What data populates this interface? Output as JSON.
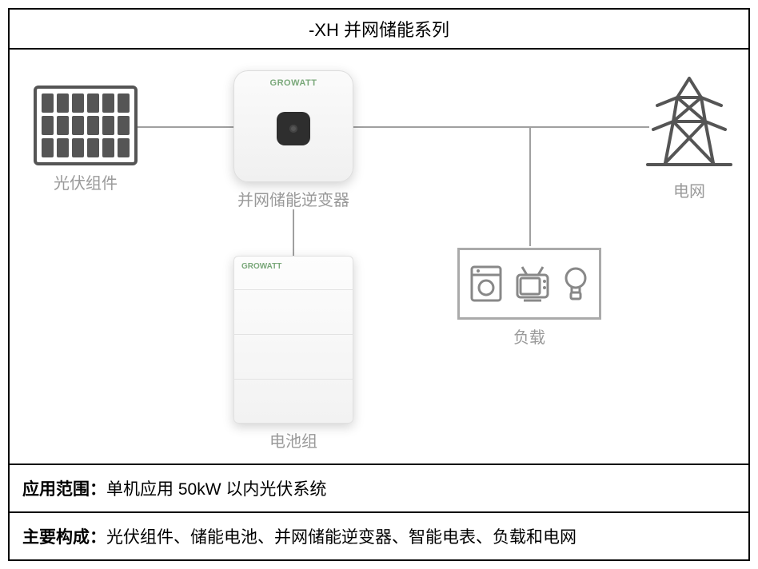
{
  "title": "-XH 并网储能系列",
  "brand": "GROWATT",
  "nodes": {
    "pv": "光伏组件",
    "inverter": "并网储能逆变器",
    "grid": "电网",
    "loads": "负载",
    "battery": "电池组"
  },
  "rows": {
    "scope_label": "应用范围：",
    "scope_value": "单机应用 50kW 以内光伏系统",
    "components_label": "主要构成：",
    "components_value": "光伏组件、储能电池、并网储能逆变器、智能电表、负载和电网"
  }
}
